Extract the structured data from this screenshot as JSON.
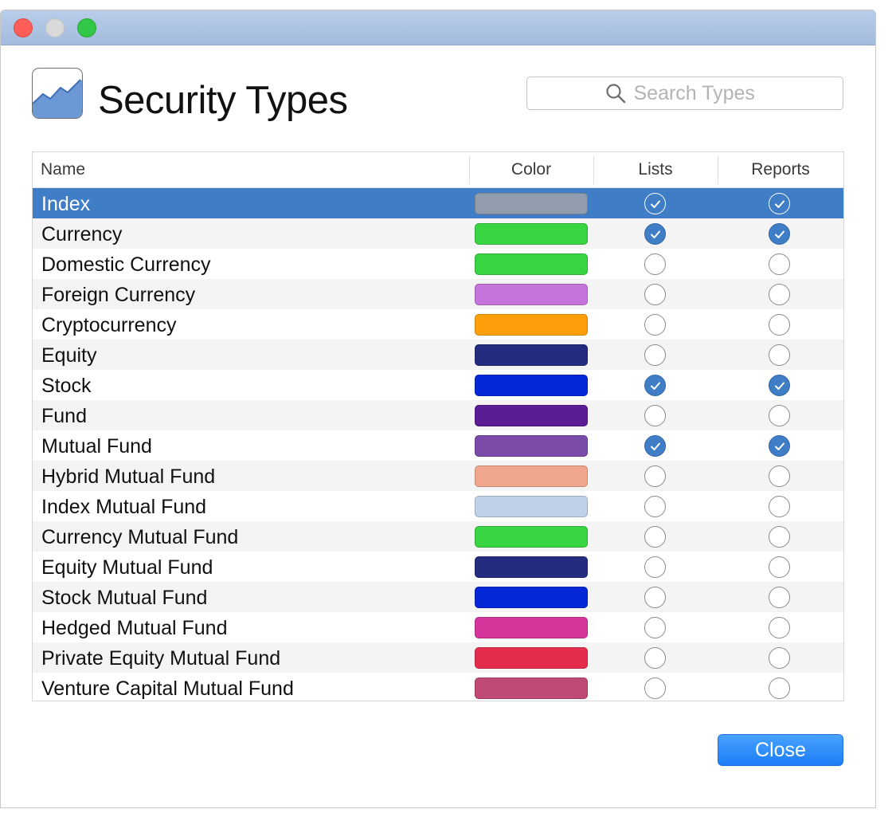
{
  "window": {
    "controls": [
      "close",
      "minimize",
      "zoom"
    ]
  },
  "header": {
    "icon": "security-chart-icon",
    "title": "Security Types",
    "search_placeholder": "Search Types",
    "search_value": ""
  },
  "table": {
    "columns": {
      "name": "Name",
      "color": "Color",
      "lists": "Lists",
      "reports": "Reports"
    },
    "rows": [
      {
        "name": "Index",
        "color": "#919cae",
        "lists": true,
        "reports": true,
        "selected": true
      },
      {
        "name": "Currency",
        "color": "#38d442",
        "lists": true,
        "reports": true,
        "selected": false
      },
      {
        "name": "Domestic Currency",
        "color": "#38d442",
        "lists": false,
        "reports": false,
        "selected": false
      },
      {
        "name": "Foreign Currency",
        "color": "#c574dc",
        "lists": false,
        "reports": false,
        "selected": false
      },
      {
        "name": "Cryptocurrency",
        "color": "#fc9f0a",
        "lists": false,
        "reports": false,
        "selected": false
      },
      {
        "name": "Equity",
        "color": "#252b7e",
        "lists": false,
        "reports": false,
        "selected": false
      },
      {
        "name": "Stock",
        "color": "#0428d6",
        "lists": true,
        "reports": true,
        "selected": false
      },
      {
        "name": "Fund",
        "color": "#5b1c94",
        "lists": false,
        "reports": false,
        "selected": false
      },
      {
        "name": "Mutual Fund",
        "color": "#7a4ba8",
        "lists": true,
        "reports": true,
        "selected": false
      },
      {
        "name": "Hybrid Mutual Fund",
        "color": "#f0a68d",
        "lists": false,
        "reports": false,
        "selected": false
      },
      {
        "name": "Index Mutual Fund",
        "color": "#bfd1e9",
        "lists": false,
        "reports": false,
        "selected": false
      },
      {
        "name": "Currency Mutual Fund",
        "color": "#38d442",
        "lists": false,
        "reports": false,
        "selected": false
      },
      {
        "name": "Equity Mutual Fund",
        "color": "#252b7e",
        "lists": false,
        "reports": false,
        "selected": false
      },
      {
        "name": "Stock Mutual Fund",
        "color": "#0428d6",
        "lists": false,
        "reports": false,
        "selected": false
      },
      {
        "name": "Hedged Mutual Fund",
        "color": "#d6359c",
        "lists": false,
        "reports": false,
        "selected": false
      },
      {
        "name": "Private Equity Mutual Fund",
        "color": "#e42d4d",
        "lists": false,
        "reports": false,
        "selected": false
      },
      {
        "name": "Venture Capital Mutual Fund",
        "color": "#c04a76",
        "lists": false,
        "reports": false,
        "selected": false
      }
    ]
  },
  "footer": {
    "close_label": "Close"
  },
  "colors": {
    "accent": "#3f7dc6",
    "button": "#1c7ef7",
    "titlebar": "#b0c6e5"
  }
}
